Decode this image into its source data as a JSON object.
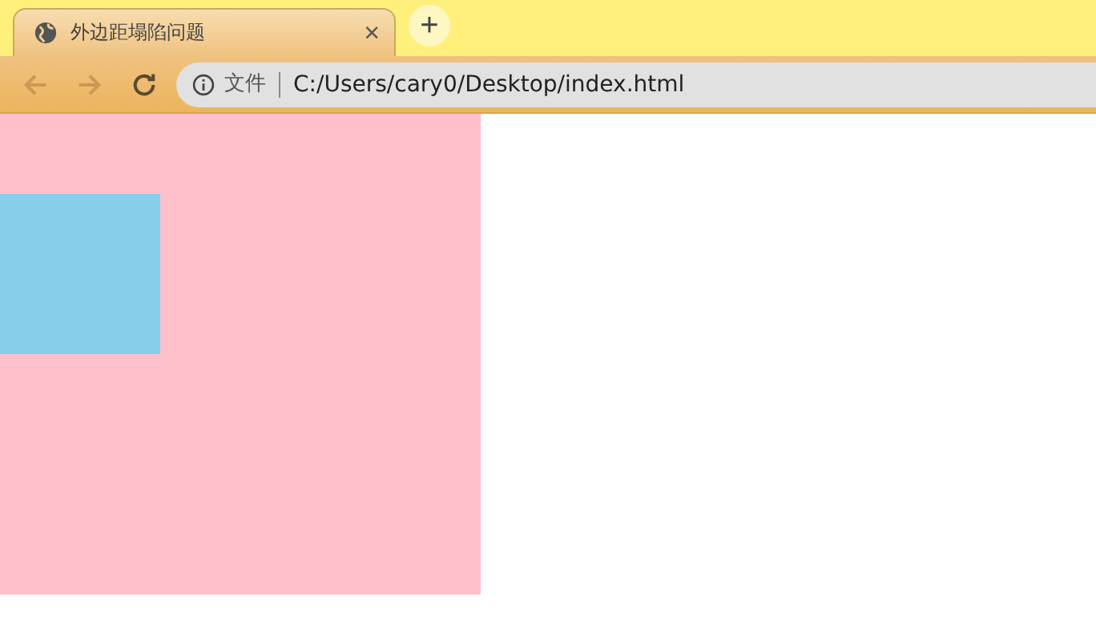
{
  "tabs": [
    {
      "title": "外边距塌陷问题",
      "selected": true,
      "close": "×"
    }
  ],
  "new_tab": "+",
  "nav": [
    {
      "kind": "back",
      "disabled": true
    },
    {
      "kind": "forward",
      "disabled": true
    },
    {
      "kind": "reload",
      "disabled": false
    }
  ],
  "address": {
    "scheme": "文件",
    "url": "C:/Users/cary0/Desktop/index.html"
  },
  "page": {
    "boxes": [
      {
        "kind": "outer",
        "color": "#ffc0cb"
      },
      {
        "kind": "inner",
        "color": "#87ceeb"
      }
    ]
  }
}
